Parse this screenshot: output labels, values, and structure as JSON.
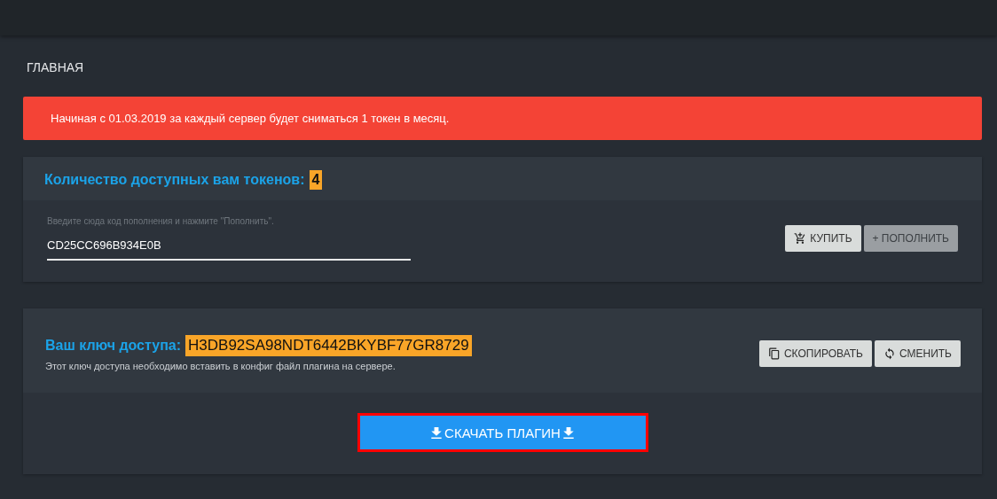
{
  "page_title": "ГЛАВНАЯ",
  "alert": {
    "text": "Начиная с 01.03.2019 за каждый сервер будет сниматься 1 токен в месяц."
  },
  "tokens": {
    "label": "Количество доступных вам токенов:",
    "count": "4",
    "field": {
      "label": "Введите сюда код пополнения и нажмите \"Пополнить\".",
      "value": "CD25CC696B934E0B"
    },
    "buttons": [
      {
        "kind": "cart",
        "label": "КУПИТЬ",
        "disabled": false
      },
      {
        "kind": "plus",
        "label": "+ ПОПОЛНИТЬ",
        "disabled": true
      }
    ]
  },
  "access_key": {
    "label": "Ваш ключ доступа:",
    "key": "H3DB92SA98NDT6442BKYBF77GR8729",
    "hint": "Этот ключ доступа необходимо вставить в конфиг файл плагина на сервере.",
    "buttons": [
      {
        "kind": "copy",
        "label": "СКОПИРОВАТЬ",
        "disabled": false
      },
      {
        "kind": "refresh",
        "label": "СМЕНИТЬ",
        "disabled": false
      }
    ]
  },
  "download": {
    "label": "СКАЧАТЬ ПЛАГИН",
    "focused": true
  }
}
